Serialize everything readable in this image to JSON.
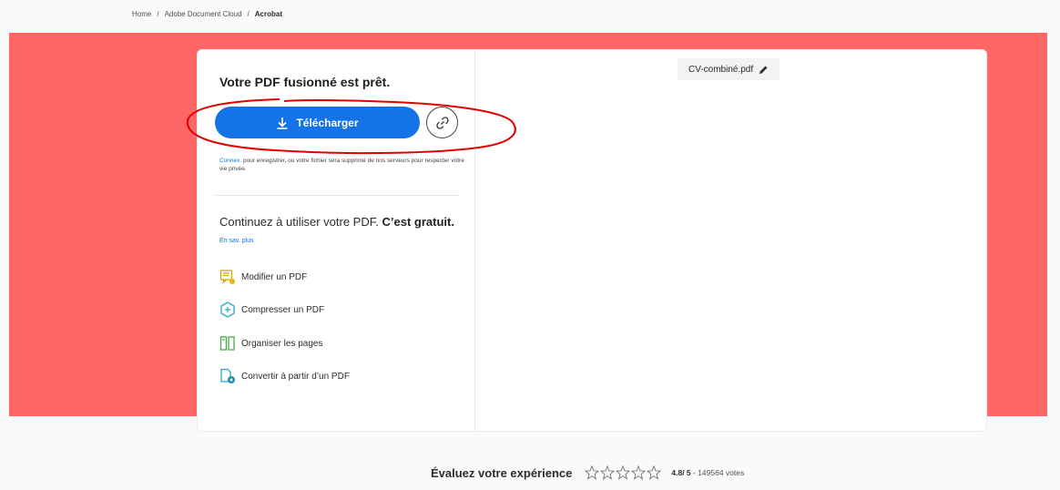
{
  "breadcrumb": {
    "items": [
      "Home",
      "Adobe Document Cloud",
      "Acrobat"
    ],
    "separator": "/"
  },
  "result": {
    "title": "Votre PDF fusionné est prêt.",
    "download_label": "Télécharger",
    "notice_link": "Connex.",
    "notice_text": " pour enregistrer, ou votre fichier sera supprimé de nos serveurs pour respecter votre vie privée."
  },
  "continue_section": {
    "heading": "Continuez à utiliser votre PDF.",
    "heading_bold": "C’est gratuit.",
    "learn_more": "En sav. plus",
    "tools": [
      {
        "label": "Modifier un PDF",
        "icon": "edit-pdf-icon"
      },
      {
        "label": "Compresser un PDF",
        "icon": "compress-pdf-icon"
      },
      {
        "label": "Organiser les pages",
        "icon": "organize-pages-icon"
      },
      {
        "label": "Convertir à partir d’un PDF",
        "icon": "convert-pdf-icon"
      }
    ]
  },
  "preview": {
    "filename": "CV-combiné.pdf"
  },
  "rating": {
    "label": "Évaluez votre expérience",
    "score": "4.8",
    "max": "/ 5",
    "votes": " - 149564 votes",
    "stars_count": 5
  },
  "colors": {
    "hero_bg": "#ff6767",
    "accent": "#1473e6",
    "annotation": "#e00000"
  }
}
